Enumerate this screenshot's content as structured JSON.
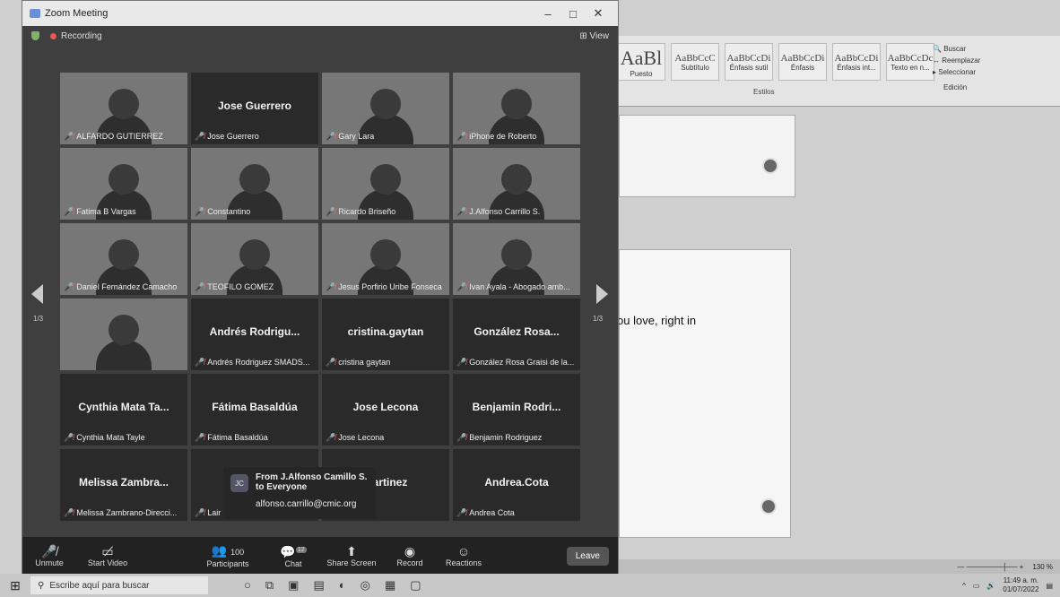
{
  "window": {
    "title": "Zoom Meeting",
    "minimize": "–",
    "maximize": "□",
    "close": "✕"
  },
  "top": {
    "recording": "Recording",
    "view": "View"
  },
  "tiles": [
    {
      "label": "ALFARDO GUTIERREZ",
      "big": "",
      "video": true
    },
    {
      "label": "Jose Guerrero",
      "big": "Jose Guerrero",
      "video": false
    },
    {
      "label": "Gary Lara",
      "big": "",
      "video": true
    },
    {
      "label": "iPhone de Roberto",
      "big": "",
      "video": true
    },
    {
      "label": "Fatima B Vargas",
      "big": "",
      "video": true
    },
    {
      "label": "Constantino",
      "big": "",
      "video": true
    },
    {
      "label": "Ricardo Briseño",
      "big": "",
      "video": true
    },
    {
      "label": "J.Alfonso Carrillo S.",
      "big": "",
      "video": true
    },
    {
      "label": "Daniel Fernández Camacho",
      "big": "",
      "video": true
    },
    {
      "label": "TEOFILO GOMEZ",
      "big": "",
      "video": true
    },
    {
      "label": "Jesus Porfirio Uribe Fonseca",
      "big": "",
      "video": true
    },
    {
      "label": "Ivan Ayala - Abogado amb...",
      "big": "",
      "video": true
    },
    {
      "label": "",
      "big": "",
      "video": true
    },
    {
      "label": "Andrés Rodriguez SMADS...",
      "big": "Andrés Rodrigu...",
      "video": false
    },
    {
      "label": "cristina gaytan",
      "big": "cristina.gaytan",
      "video": false
    },
    {
      "label": "González Rosa Graisi de la...",
      "big": "González Rosa...",
      "video": false
    },
    {
      "label": "Cynthia Mata Tayle",
      "big": "Cynthia Mata Ta...",
      "video": false
    },
    {
      "label": "Fátima Basaldúa",
      "big": "Fátima Basaldúa",
      "video": false
    },
    {
      "label": "Jose Lecona",
      "big": "Jose Lecona",
      "video": false
    },
    {
      "label": "Benjamin Rodriguez",
      "big": "Benjamin Rodri...",
      "video": false
    },
    {
      "label": "Melissa Zambrano-Direcci...",
      "big": "Melissa Zambra...",
      "video": false
    },
    {
      "label": "Lair",
      "big": "",
      "video": false
    },
    {
      "label": "...nez",
      "big": "...artinez",
      "video": false
    },
    {
      "label": "Andrea Cota",
      "big": "Andrea.Cota",
      "video": false
    }
  ],
  "pager": {
    "left": "1/3",
    "right": "1/3"
  },
  "chat": {
    "initials": "JC",
    "from": "From J.Alfonso Camillo S. to Everyone",
    "message": "alfonso.carrillo@cmic.org"
  },
  "toolbar": {
    "unmute": "Unmute",
    "video": "Start Video",
    "participants": "Participants",
    "participants_count": "100",
    "chat": "Chat",
    "chat_badge": "12",
    "share": "Share Screen",
    "record": "Record",
    "reactions": "Reactions",
    "leave": "Leave"
  },
  "word": {
    "styles": [
      {
        "sample": "AaBl",
        "name": "Puesto"
      },
      {
        "sample": "AaBbCcC",
        "name": "Subtítulo"
      },
      {
        "sample": "AaBbCcDi",
        "name": "Énfasis sutil"
      },
      {
        "sample": "AaBbCcDi",
        "name": "Énfasis"
      },
      {
        "sample": "AaBbCcDi",
        "name": "Énfasis int..."
      },
      {
        "sample": "AaBbCcDc",
        "name": "Texto en n..."
      }
    ],
    "styles_group": "Estilos",
    "find": "Buscar",
    "replace": "Reemplazar",
    "select": "Seleccionar",
    "edit_group": "Edición",
    "doc_text": "ou love, right in",
    "zoom_level": "130 %"
  },
  "taskbar": {
    "search_placeholder": "Escribe aquí para buscar",
    "time": "11:49 a. m.",
    "date": "01/07/2022"
  }
}
